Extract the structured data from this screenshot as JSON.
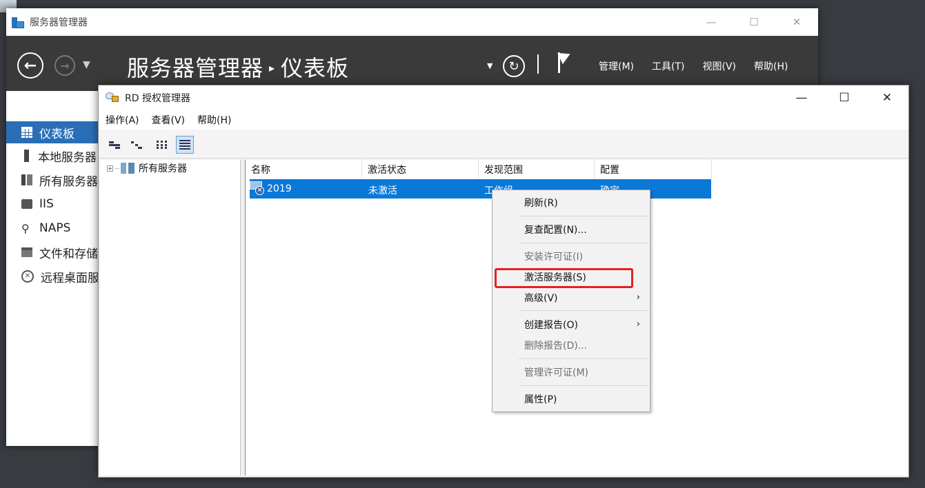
{
  "server_manager": {
    "title": "服务器管理器",
    "breadcrumb_root": "服务器管理器",
    "breadcrumb_page": "仪表板",
    "menus": [
      "管理(M)",
      "工具(T)",
      "视图(V)",
      "帮助(H)"
    ],
    "sidebar": [
      {
        "label": "仪表板",
        "icon": "dashboard-icon",
        "active": true
      },
      {
        "label": "本地服务器",
        "icon": "server-icon"
      },
      {
        "label": "所有服务器",
        "icon": "servers-icon"
      },
      {
        "label": "IIS",
        "icon": "iis-icon"
      },
      {
        "label": "NAPS",
        "icon": "naps-icon"
      },
      {
        "label": "文件和存储服务",
        "icon": "storage-icon"
      },
      {
        "label": "远程桌面服务",
        "icon": "remote-desktop-icon"
      }
    ]
  },
  "rd_window": {
    "title": "RD 授权管理器",
    "menus": [
      "操作(A)",
      "查看(V)",
      "帮助(H)"
    ],
    "tree_root": "所有服务器",
    "columns": [
      "名称",
      "激活状态",
      "发现范围",
      "配置"
    ],
    "rows": [
      {
        "name": "2019",
        "status": "未激活",
        "scope": "工作组",
        "config": "确定"
      }
    ]
  },
  "context_menu": {
    "items": [
      {
        "label": "刷新(R)",
        "enabled": true
      },
      {
        "label": "复查配置(N)...",
        "enabled": true
      },
      {
        "label": "安装许可证(I)",
        "enabled": false
      },
      {
        "label": "激活服务器(S)",
        "enabled": true,
        "highlighted": true
      },
      {
        "label": "高级(V)",
        "enabled": true,
        "submenu": true
      },
      {
        "label": "创建报告(O)",
        "enabled": true,
        "submenu": true
      },
      {
        "label": "删除报告(D)...",
        "enabled": false
      },
      {
        "label": "管理许可证(M)",
        "enabled": false
      },
      {
        "label": "属性(P)",
        "enabled": true
      }
    ]
  },
  "colors": {
    "selection": "#0a78d7",
    "sidebar_active": "#2a6fb6",
    "header_bg": "#3a3a3a",
    "highlight_box": "#e52020"
  }
}
